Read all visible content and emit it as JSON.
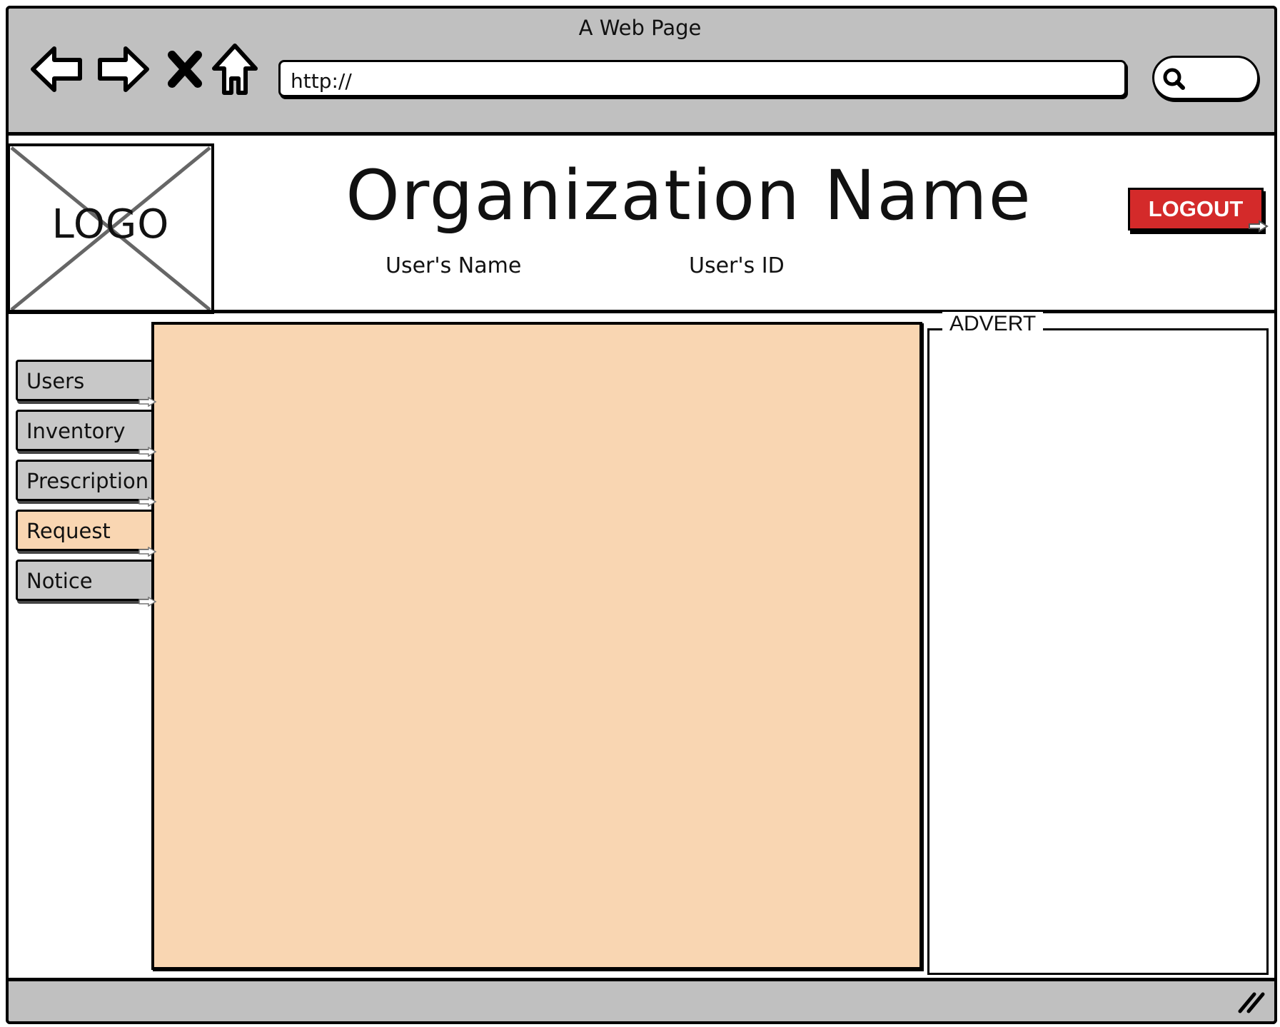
{
  "window": {
    "title": "A Web Page"
  },
  "address_bar": {
    "value": "http://"
  },
  "header": {
    "logo_text": "LOGO",
    "organization_name": "Organization Name",
    "user_name": "User's Name",
    "user_id": "User's ID",
    "logout_label": "LOGOUT"
  },
  "sidebar": {
    "items": [
      {
        "label": "Users",
        "active": false
      },
      {
        "label": "Inventory",
        "active": false
      },
      {
        "label": "Prescription",
        "active": false
      },
      {
        "label": "Request",
        "active": true
      },
      {
        "label": "Notice",
        "active": false
      }
    ]
  },
  "advert": {
    "label": "ADVERT"
  },
  "colors": {
    "chrome": "#c0c0c0",
    "content_fill": "#f9d6b2",
    "logout_button": "#d42a2a",
    "nav_inactive": "#c8c8c8"
  },
  "icons": [
    "back-arrow-icon",
    "forward-arrow-icon",
    "stop-icon",
    "home-icon",
    "search-icon",
    "link-arrow-icon",
    "resize-grip-icon"
  ]
}
